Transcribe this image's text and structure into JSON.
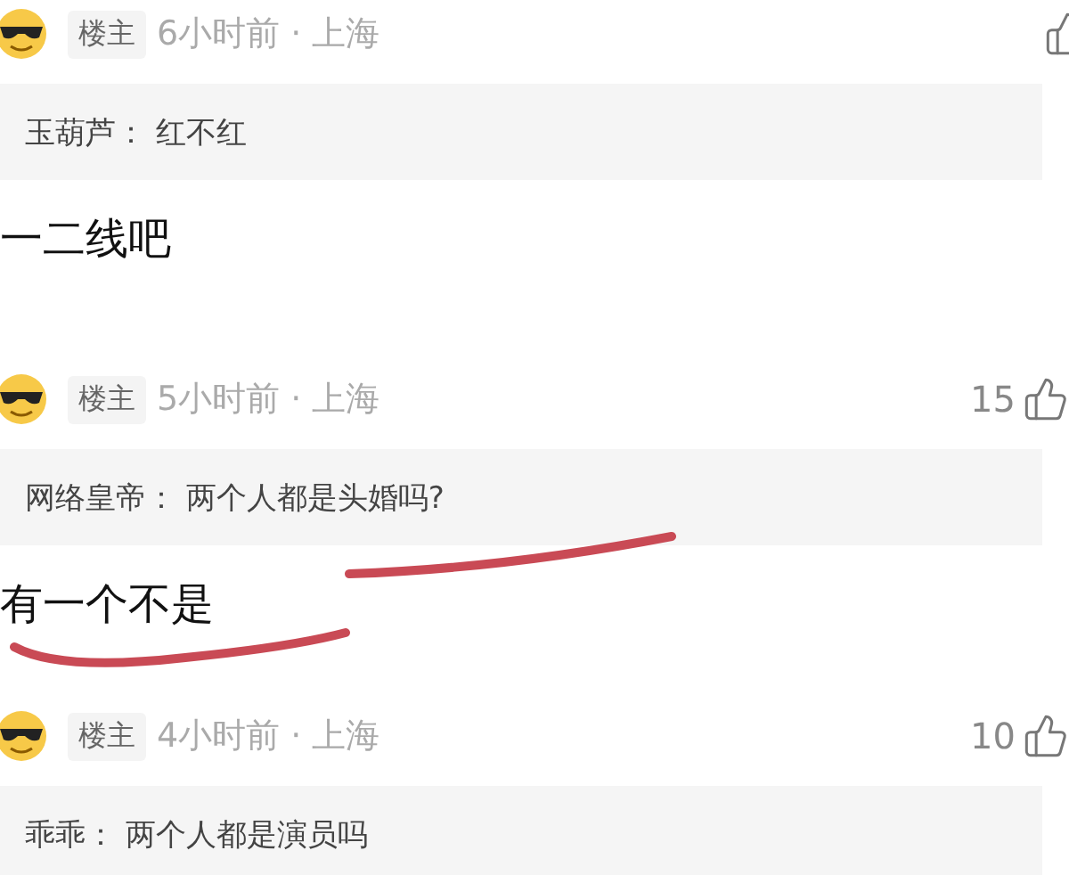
{
  "comments": [
    {
      "author_badge": "楼主",
      "time": "6小时前 · 上海",
      "quote": {
        "author": "玉葫芦：",
        "text": "红不红",
        "underlined": false
      },
      "reply": {
        "text": "一二线吧",
        "underlined": false
      }
    },
    {
      "author_badge": "楼主",
      "time": "5小时前 · 上海",
      "likes": "15",
      "quote": {
        "author": "网络皇帝：",
        "text": "两个人都是头婚吗?",
        "underlined": true
      },
      "reply": {
        "text": "有一个不是",
        "underlined": true
      }
    },
    {
      "author_badge": "楼主",
      "time": "4小时前 · 上海",
      "likes": "10",
      "quote": {
        "author": "乖乖：",
        "text": "两个人都是演员吗",
        "underlined": false
      }
    }
  ]
}
